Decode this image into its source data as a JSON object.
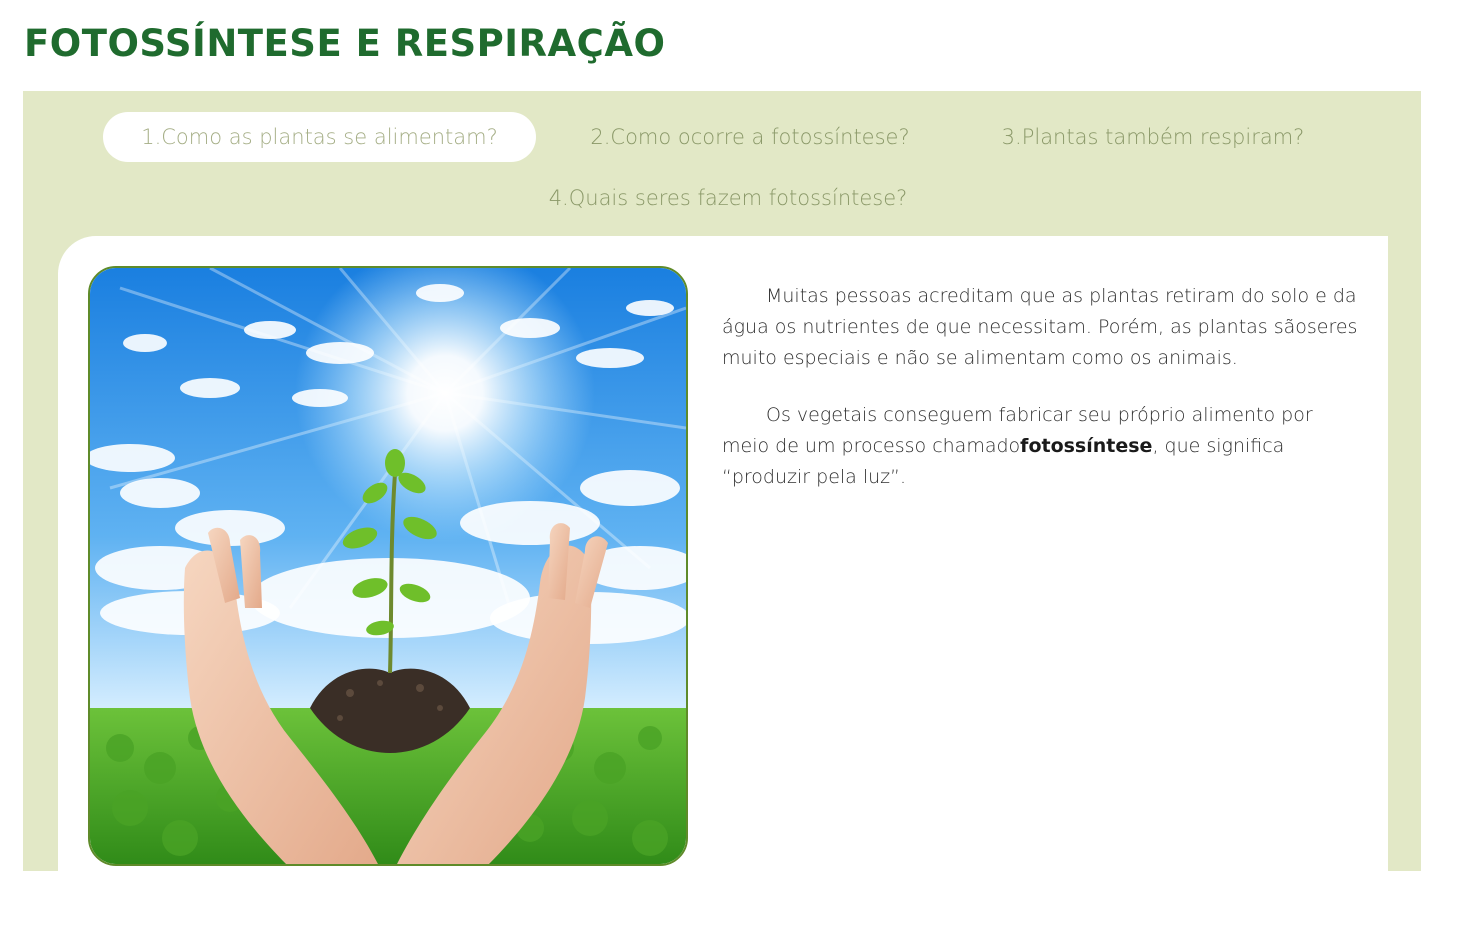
{
  "page": {
    "title": "FOTOSSÍNTESE E RESPIRAÇÃO"
  },
  "tabs": [
    {
      "label": "1.Como as plantas se alimentam?",
      "active": true
    },
    {
      "label": "2.Como ocorre a fotossíntese?",
      "active": false
    },
    {
      "label": "3.Plantas também respiram?",
      "active": false
    },
    {
      "label": "4.Quais seres fazem fotossíntese?",
      "active": false
    }
  ],
  "content": {
    "paragraph1": "Muitas pessoas acreditam que as plantas retiram do solo e da água os nutrientes de que necessitam. Porém, as plantas sãoseres muito especiais e não se alimentam como os animais.",
    "paragraph2_before": "Os vegetais conseguem fabricar seu próprio alimento por meio de um processo chamado",
    "paragraph2_bold": "fotossíntese",
    "paragraph2_after": ", que significa “produzir pela luz”."
  },
  "colors": {
    "title": "#1f6b2e",
    "panel_bg": "#e2e8c6",
    "tab_text": "#8a9868",
    "photo_border": "#5f8b2a"
  },
  "image": {
    "subject": "hands-holding-seedling-under-sun"
  }
}
